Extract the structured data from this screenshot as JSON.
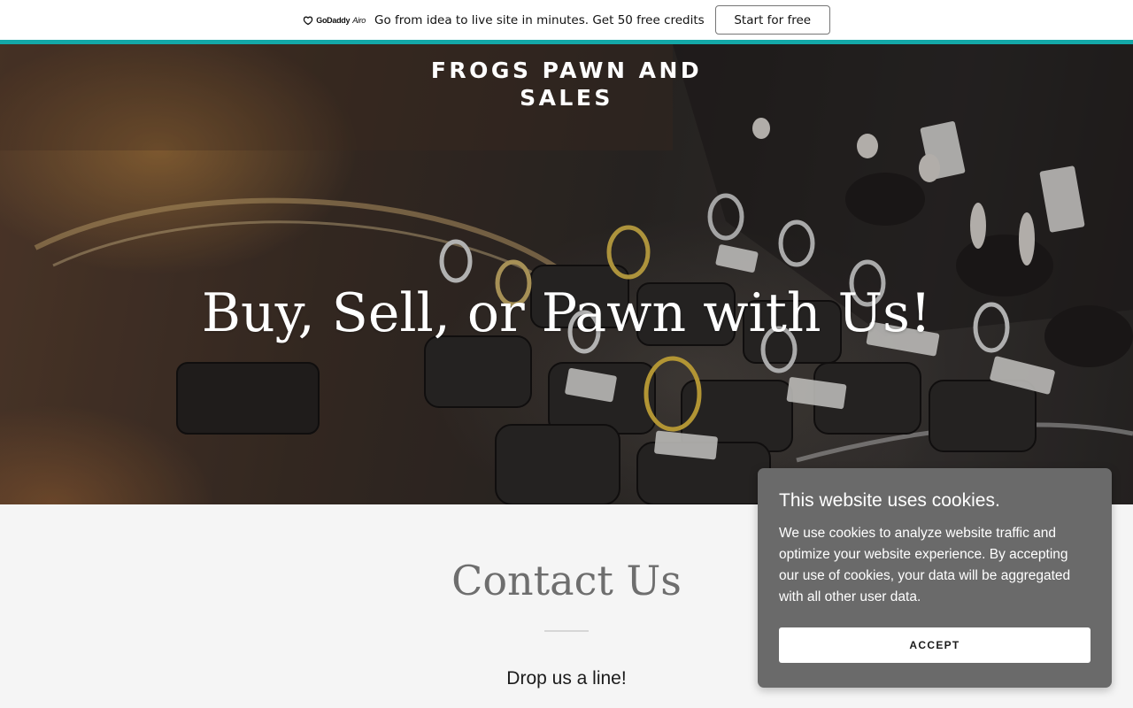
{
  "promo_banner": {
    "logo_text": "GoDaddy",
    "logo_suffix": "Airo",
    "message": "Go from idea to live site in minutes. Get 50 free credits",
    "cta_label": "Start for free"
  },
  "header": {
    "brand_name": "FROGS PAWN AND SALES"
  },
  "hero": {
    "title": "Buy, Sell, or Pawn with Us!"
  },
  "contact": {
    "title": "Contact Us",
    "subtitle": "Drop us a line!"
  },
  "cookie_notice": {
    "title": "This website uses cookies.",
    "body": "We use cookies to analyze website traffic and optimize your website experience. By accepting our use of cookies, your data will be aggregated with all other user data.",
    "accept_label": "ACCEPT"
  },
  "colors": {
    "accent_bar": "#14a8a8",
    "cookie_background": "#6a6a6a",
    "page_background": "#f5f5f5",
    "contact_title": "#6e6e6e"
  }
}
